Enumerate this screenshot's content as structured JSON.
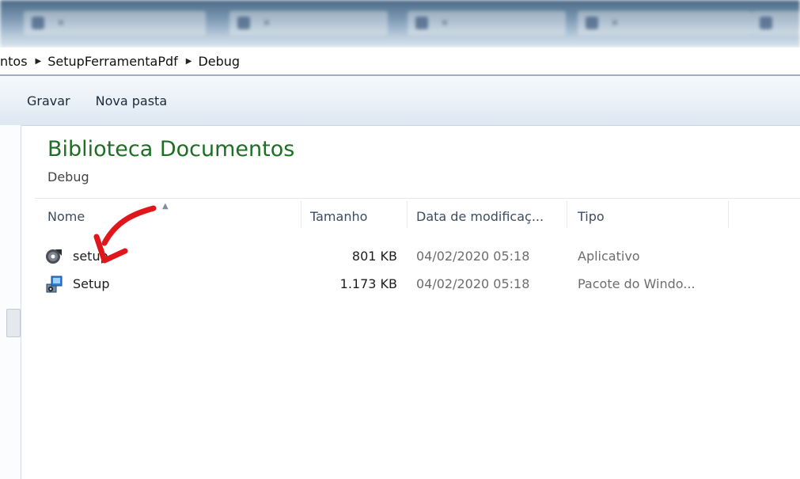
{
  "breadcrumb": {
    "items": [
      "ntos",
      "SetupFerramentaPdf",
      "Debug"
    ]
  },
  "toolbar": {
    "burn_label": "Gravar",
    "new_folder_label": "Nova pasta"
  },
  "library": {
    "title": "Biblioteca Documentos",
    "subtitle": "Debug"
  },
  "columns": {
    "name": "Nome",
    "size": "Tamanho",
    "date": "Data de modificaç...",
    "type": "Tipo"
  },
  "files": [
    {
      "name": "setup",
      "icon": "installer-disc-icon",
      "size": "801 KB",
      "date": "04/02/2020 05:18",
      "type": "Aplicativo"
    },
    {
      "name": "Setup",
      "icon": "windows-installer-package-icon",
      "size": "1.173 KB",
      "date": "04/02/2020 05:18",
      "type": "Pacote do Windo..."
    }
  ],
  "annotation": {
    "icon": "red-arrow-icon",
    "color": "#e0161b"
  },
  "colors": {
    "library_title": "#1e6e23",
    "toolbar_bg": "#e9f0f7",
    "taskbar": "#6a89a6"
  }
}
